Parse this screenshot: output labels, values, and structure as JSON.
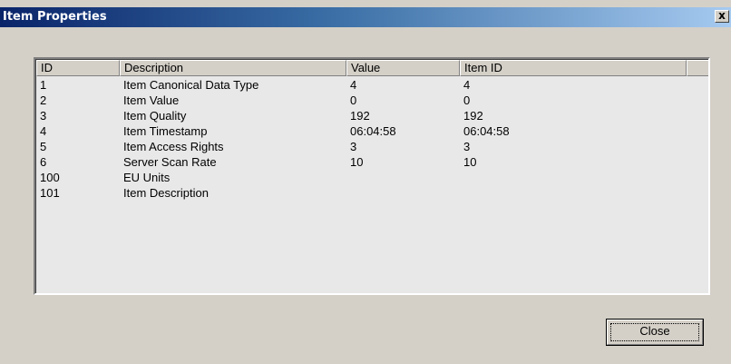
{
  "window": {
    "title": "Item Properties",
    "close_glyph": "x"
  },
  "table": {
    "columns": [
      "ID",
      "Description",
      "Value",
      "Item ID"
    ],
    "rows": [
      [
        "1",
        "Item Canonical Data Type",
        "4",
        "4"
      ],
      [
        "2",
        "Item Value",
        "0",
        "0"
      ],
      [
        "3",
        "Item Quality",
        "192",
        "192"
      ],
      [
        "4",
        "Item Timestamp",
        "06:04:58",
        "06:04:58"
      ],
      [
        "5",
        "Item Access Rights",
        "3",
        "3"
      ],
      [
        "6",
        "Server Scan Rate",
        "10",
        "10"
      ],
      [
        "100",
        "EU Units",
        "",
        ""
      ],
      [
        "101",
        "Item Description",
        "",
        ""
      ]
    ]
  },
  "buttons": {
    "close_label": "Close"
  },
  "colors": {
    "face": "#d4d0c8",
    "title_start": "#0a246a",
    "title_end": "#a6caf0",
    "list_bg": "#e8e8e8"
  }
}
